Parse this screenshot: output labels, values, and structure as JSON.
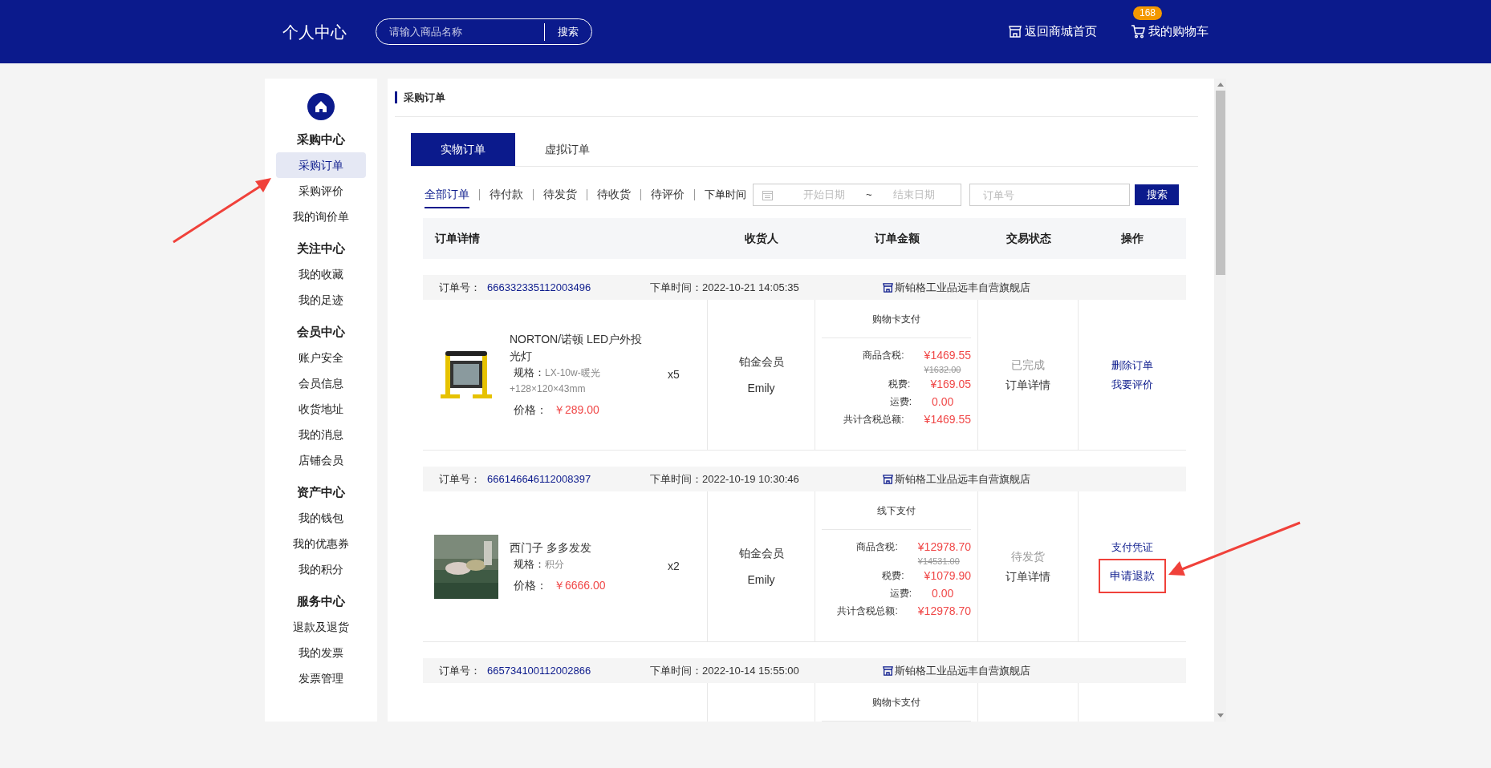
{
  "header": {
    "title": "个人中心",
    "search": {
      "placeholder": "请输入商品名称",
      "button": "搜索"
    },
    "home_link": "返回商城首页",
    "cart": {
      "label": "我的购物车",
      "badge": "168"
    }
  },
  "sidebar": {
    "groups": [
      {
        "title": "采购中心",
        "items": [
          {
            "label": "采购订单",
            "selected": true
          },
          {
            "label": "采购评价",
            "selected": false
          },
          {
            "label": "我的询价单",
            "selected": false
          }
        ]
      },
      {
        "title": "关注中心",
        "items": [
          {
            "label": "我的收藏",
            "selected": false
          },
          {
            "label": "我的足迹",
            "selected": false
          }
        ]
      },
      {
        "title": "会员中心",
        "items": [
          {
            "label": "账户安全",
            "selected": false
          },
          {
            "label": "会员信息",
            "selected": false
          },
          {
            "label": "收货地址",
            "selected": false
          },
          {
            "label": "我的消息",
            "selected": false
          },
          {
            "label": "店铺会员",
            "selected": false
          }
        ]
      },
      {
        "title": "资产中心",
        "items": [
          {
            "label": "我的钱包",
            "selected": false
          },
          {
            "label": "我的优惠券",
            "selected": false
          },
          {
            "label": "我的积分",
            "selected": false
          }
        ]
      },
      {
        "title": "服务中心",
        "items": [
          {
            "label": "退款及退货",
            "selected": false
          },
          {
            "label": "我的发票",
            "selected": false
          },
          {
            "label": "发票管理",
            "selected": false
          }
        ]
      }
    ]
  },
  "panel": {
    "title": "采购订单",
    "tabs": [
      {
        "label": "实物订单",
        "selected": true
      },
      {
        "label": "虚拟订单",
        "selected": false
      }
    ],
    "status_tabs": [
      {
        "label": "全部订单",
        "selected": true
      },
      {
        "label": "待付款",
        "selected": false
      },
      {
        "label": "待发货",
        "selected": false
      },
      {
        "label": "待收货",
        "selected": false
      },
      {
        "label": "待评价",
        "selected": false
      }
    ],
    "filter": {
      "time_label": "下单时间",
      "start_placeholder": "开始日期",
      "separator": "~",
      "end_placeholder": "结束日期",
      "order_placeholder": "订单号",
      "button": "搜索"
    },
    "columns": [
      "订单详情",
      "收货人",
      "订单金额",
      "交易状态",
      "操作"
    ],
    "orders": [
      {
        "order_no_label": "订单号：",
        "order_no": "666332335112003496",
        "time_label": "下单时间：",
        "time": "2022-10-21 14:05:35",
        "store": "斯铂格工业品远丰自营旗舰店",
        "product": {
          "kind": "lamp",
          "name": "NORTON/诺顿 LED户外投光灯",
          "spec_label": "规格：",
          "spec": "LX-10w-暖光+128×120×43mm",
          "price_label": "价格：",
          "price": "￥289.00"
        },
        "qty": "x5",
        "receiver": {
          "level": "铂金会员",
          "name": "Emily"
        },
        "payment": "购物卡支付",
        "amounts": [
          {
            "label": "商品含税:",
            "value": "¥1469.55",
            "original": "¥1632.00"
          },
          {
            "label": "税费:",
            "value": "¥169.05"
          },
          {
            "label": "运费:",
            "value": "0.00"
          },
          {
            "label": "共计含税总额:",
            "value": "¥1469.55"
          }
        ],
        "status": "已完成",
        "detail": "订单详情",
        "actions": [
          {
            "label": "删除订单",
            "boxed": false
          },
          {
            "label": "我要评价",
            "boxed": false
          }
        ]
      },
      {
        "order_no_label": "订单号：",
        "order_no": "666146646112008397",
        "time_label": "下单时间：",
        "time": "2022-10-19 10:30:46",
        "store": "斯铂格工业品远丰自营旗舰店",
        "product": {
          "kind": "bedroom",
          "name": "西门子 多多发发",
          "spec_label": "规格：",
          "spec": "积分",
          "price_label": "价格：",
          "price": "￥6666.00"
        },
        "qty": "x2",
        "receiver": {
          "level": "铂金会员",
          "name": "Emily"
        },
        "payment": "线下支付",
        "amounts": [
          {
            "label": "商品含税:",
            "value": "¥12978.70",
            "original": "¥14531.00"
          },
          {
            "label": "税费:",
            "value": "¥1079.90"
          },
          {
            "label": "运费:",
            "value": "0.00"
          },
          {
            "label": "共计含税总额:",
            "value": "¥12978.70"
          }
        ],
        "status": "待发货",
        "detail": "订单详情",
        "actions": [
          {
            "label": "支付凭证",
            "boxed": false
          },
          {
            "label": "申请退款",
            "boxed": true
          }
        ]
      },
      {
        "order_no_label": "订单号：",
        "order_no": "665734100112002866",
        "time_label": "下单时间：",
        "time": "2022-10-14 15:55:00",
        "store": "斯铂格工业品远丰自营旗舰店",
        "payment": "购物卡支付"
      }
    ]
  }
}
